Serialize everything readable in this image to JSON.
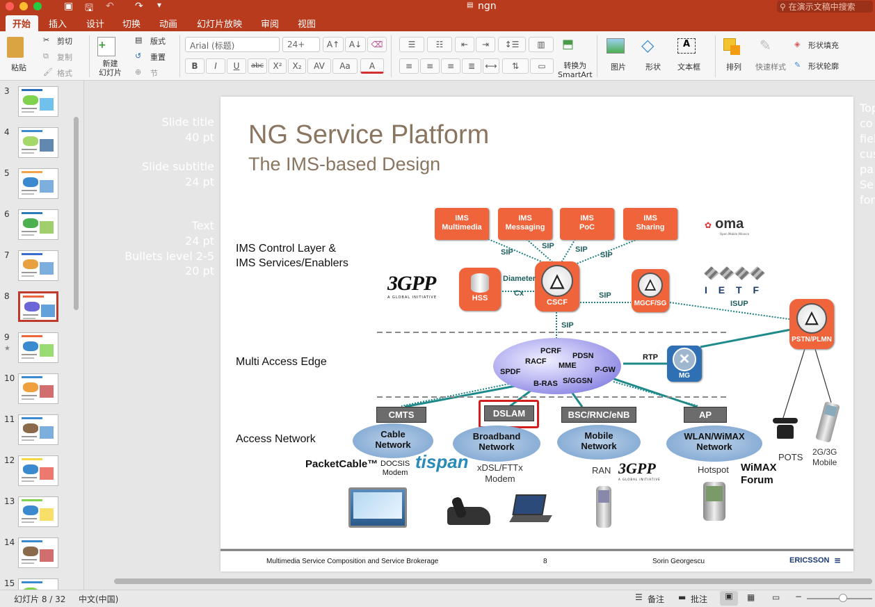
{
  "window": {
    "title": "ngn",
    "search_placeholder": "在演示文稿中搜索"
  },
  "tabs": [
    "开始",
    "插入",
    "设计",
    "切换",
    "动画",
    "幻灯片放映",
    "审阅",
    "视图"
  ],
  "ribbon": {
    "paste": "粘贴",
    "cut": "剪切",
    "copy": "复制",
    "format": "格式",
    "new_slide": "新建\n幻灯片",
    "layout": "版式",
    "reset": "重置",
    "section": "节",
    "font_name": "Arial (标题)",
    "font_size": "24+",
    "convert_smartart": "转换为\nSmartArt",
    "picture": "图片",
    "shape": "形状",
    "textbox": "文本框",
    "arrange": "排列",
    "quick_styles": "快速样式",
    "shape_fill": "形状填充",
    "shape_outline": "形状轮廓"
  },
  "thumbnails": [
    {
      "num": "3"
    },
    {
      "num": "4"
    },
    {
      "num": "5"
    },
    {
      "num": "6"
    },
    {
      "num": "7"
    },
    {
      "num": "8",
      "selected": true
    },
    {
      "num": "9",
      "star": "★"
    },
    {
      "num": "10"
    },
    {
      "num": "11"
    },
    {
      "num": "12"
    },
    {
      "num": "13"
    },
    {
      "num": "14"
    },
    {
      "num": "15"
    }
  ],
  "ghost_left": {
    "title_a": "Slide title",
    "title_b": "40 pt",
    "sub_a": "Slide subtitle",
    "sub_b": "24 pt",
    "text_a": "Text",
    "text_b": "24 pt",
    "text_c": "Bullets level 2-5",
    "text_d": "20 pt"
  },
  "ghost_right": [
    "Top",
    "co",
    "fiel",
    "cus",
    "pa",
    "Se",
    "for"
  ],
  "slide": {
    "title": "NG Service Platform",
    "subtitle": "The IMS-based Design",
    "layer_control": "IMS Control Layer &\nIMS Services/Enablers",
    "layer_edge": "Multi Access Edge",
    "layer_access": "Access Network",
    "ims_boxes": [
      "IMS\nMultimedia",
      "IMS\nMessaging",
      "IMS\nPoC",
      "IMS\nSharing"
    ],
    "oma": "oma",
    "oma_sub": "Open Mobile Alliance",
    "threegpp": "3GPP",
    "threegpp_sub": "A GLOBAL INITIATIVE",
    "ietf": "I E T F",
    "nodes": {
      "hss": "HSS",
      "cscf": "CSCF",
      "mgcf": "MGCF/SG",
      "pstn": "PSTN/PLMN",
      "mg": "MG"
    },
    "links": {
      "diameter": "Diameter",
      "cx": "Cx",
      "sip": "SIP",
      "isup": "ISUP",
      "rtp": "RTP"
    },
    "edge": {
      "pcrf": "PCRF",
      "pdsn": "PDSN",
      "racf": "RACF",
      "mme": "MME",
      "spdf": "SPDF",
      "pgw": "P-GW",
      "bras": "B-RAS",
      "sggsn": "S/GGSN"
    },
    "access_boxes": [
      "CMTS",
      "DSLAM",
      "BSC/RNC/eNB",
      "AP"
    ],
    "clouds": [
      "Cable\nNetwork",
      "Broadband\nNetwork",
      "Mobile\nNetwork",
      "WLAN/WiMAX\nNetwork"
    ],
    "labels": {
      "packetcable": "PacketCable™",
      "docsis": "DOCSIS\nModem",
      "tispan": "tispan",
      "xdsl": "xDSL/FTTx\nModem",
      "ran": "RAN",
      "hotspot": "Hotspot",
      "wimax": "WiMAX\nForum",
      "pots": "POTS",
      "mobile": "2G/3G\nMobile"
    },
    "footer": {
      "left": "Multimedia Service Composition and Service Brokerage",
      "page": "8",
      "author": "Sorin Georgescu",
      "brand": "ERICSSON"
    }
  },
  "status": {
    "slide": "幻灯片 8 / 32",
    "lang": "中文(中国)",
    "notes": "备注",
    "comments": "批注"
  },
  "colors": {
    "accent": "#b83b1d",
    "node": "#f0643c",
    "link": "#1e7f7f"
  }
}
